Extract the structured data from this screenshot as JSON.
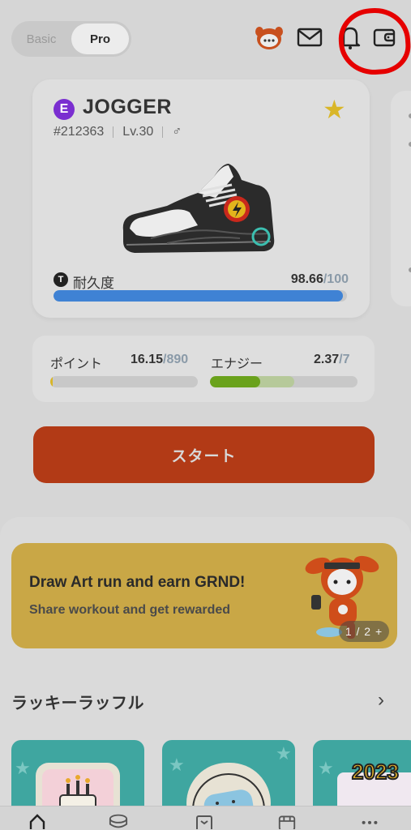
{
  "header": {
    "mode_toggle": {
      "options": [
        "Basic",
        "Pro"
      ],
      "selected": "Pro"
    },
    "icons": [
      "chat-mascot-icon",
      "mail-icon",
      "bell-icon",
      "wallet-icon"
    ]
  },
  "sneaker": {
    "rarity_badge": "E",
    "type": "JOGGER",
    "id": "#212363",
    "level": "Lv.30",
    "gender_symbol": "♂",
    "favorite": true,
    "durability_icon": "T",
    "durability_label": "耐久度",
    "durability_value": "98.66",
    "durability_max": "/100",
    "durability_fraction": 0.9866
  },
  "stats": {
    "points_label": "ポイント",
    "points_value": "16.15",
    "points_max": "/890",
    "points_fraction": 0.018,
    "energy_label": "エナジー",
    "energy_value": "2.37",
    "energy_max": "/7",
    "energy_fraction": 0.339,
    "energy_refill_fraction": 0.571
  },
  "start_button": "スタート",
  "banner": {
    "title": "Draw Art run and earn GRND!",
    "subtitle": "Share workout and get rewarded",
    "pager": "1 / 2 +"
  },
  "raffle": {
    "title": "ラッキーラッフル",
    "cards": [
      {
        "badge": ""
      },
      {
        "badge": ""
      },
      {
        "badge": "2023"
      }
    ]
  },
  "colors": {
    "accent_orange": "#b23a16",
    "durability_blue": "#3f82d4",
    "energy_green": "#6aa21c",
    "banner_gold": "#c9a746",
    "raffle_teal": "#3fa6a0",
    "rarity_purple": "#7a2ed0",
    "annotation_red": "#e60000"
  }
}
